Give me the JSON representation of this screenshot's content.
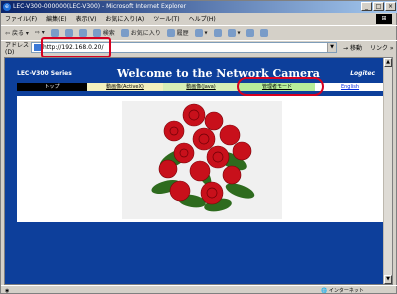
{
  "window": {
    "title": "LEC-V300-000000(LEC-V300) - Microsoft Internet Explorer"
  },
  "menu": [
    "ファイル(F)",
    "編集(E)",
    "表示(V)",
    "お気に入り(A)",
    "ツール(T)",
    "ヘルプ(H)"
  ],
  "toolbar": {
    "back": "戻る",
    "search": "検索",
    "favorites": "お気に入り",
    "history": "履歴"
  },
  "address": {
    "label": "アドレス(D)",
    "url": "http://192.168.0.20/",
    "go": "移動",
    "links": "リンク"
  },
  "page": {
    "brand": "LEC-V300 Series",
    "welcome": "Welcome to the Network Camera",
    "logo": "Logitec",
    "nav": {
      "top": "トップ",
      "activex": "動画像(ActiveX)",
      "java": "動画像(Java)",
      "admin": "管理者モード",
      "english": "English"
    }
  },
  "status": {
    "zone": "インターネット"
  }
}
